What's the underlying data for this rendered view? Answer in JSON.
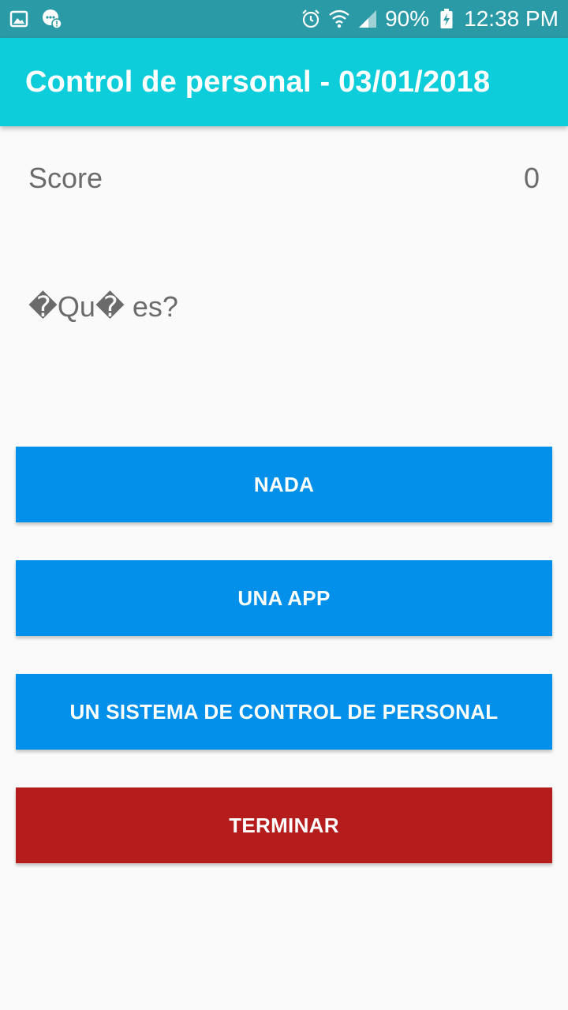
{
  "status_bar": {
    "battery": "90%",
    "time": "12:38 PM"
  },
  "app_bar": {
    "title": "Control de personal - 03/01/2018",
    "color": "#0ccdd9"
  },
  "score": {
    "label": "Score",
    "value": "0"
  },
  "question": {
    "text": "�Qu� es?"
  },
  "answers": [
    {
      "label": "NADA",
      "color": "#0290ea"
    },
    {
      "label": "UNA APP",
      "color": "#0290ea"
    },
    {
      "label": "UN SISTEMA DE CONTROL DE PERSONAL",
      "color": "#0290ea"
    }
  ],
  "finish_button": {
    "label": "TERMINAR",
    "color": "#b51c1c"
  }
}
